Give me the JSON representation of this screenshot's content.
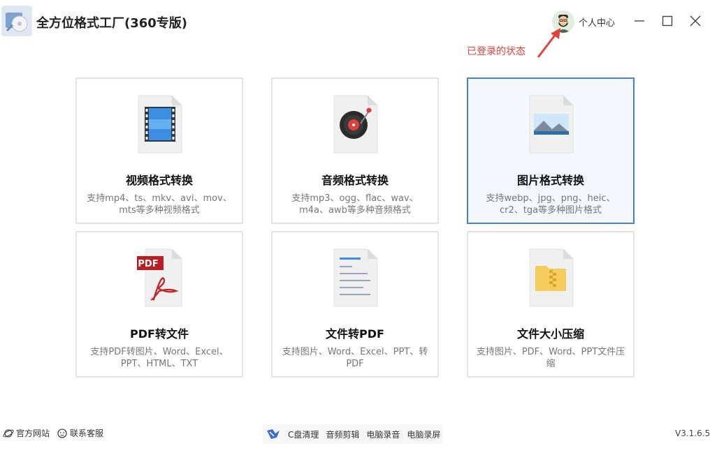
{
  "app": {
    "title": "全方位格式工厂(360专版)",
    "user_center_label": "个人中心",
    "login_note": "已登录的状态"
  },
  "cards": [
    {
      "title": "视频格式转换",
      "desc": "支持mp4、ts、mkv、avi、mov、mts等多种视频格式",
      "icon": "video-file-icon"
    },
    {
      "title": "音频格式转换",
      "desc": "支持mp3、ogg、flac、wav、m4a、awb等多种音频格式",
      "icon": "audio-file-icon"
    },
    {
      "title": "图片格式转换",
      "desc": "支持webp、jpg、png、heic、cr2、tga等多种图片格式",
      "icon": "image-file-icon",
      "selected": true
    },
    {
      "title": "PDF转文件",
      "desc": "支持PDF转图片、Word、Excel、PPT、HTML、TXT",
      "icon": "pdf-file-icon",
      "badge": "PDF"
    },
    {
      "title": "文件转PDF",
      "desc": "支持图片、Word、Excel、PPT、转PDF",
      "icon": "document-file-icon"
    },
    {
      "title": "文件大小压缩",
      "desc": "支持图片、PDF、Word、PPT文件压缩",
      "icon": "zip-file-icon"
    }
  ],
  "footer": {
    "official_site": "官方网站",
    "contact_service": "联系客服",
    "tools": [
      "C盘清理",
      "音频剪辑",
      "电脑录音",
      "电脑录屏"
    ],
    "version": "V3.1.6.5"
  },
  "colors": {
    "selected_border": "#4a7fd6",
    "annotation": "#e8413a"
  }
}
